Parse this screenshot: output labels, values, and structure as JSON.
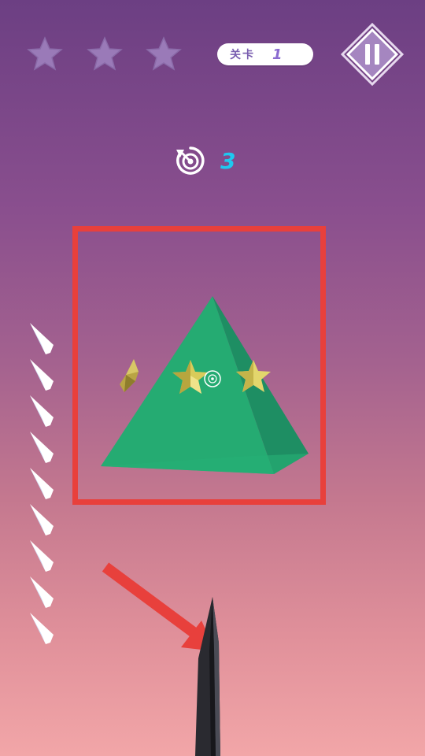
{
  "hud": {
    "stars": [
      {
        "icon": "star-icon",
        "earned": false
      },
      {
        "icon": "star-icon",
        "earned": false
      },
      {
        "icon": "star-icon",
        "earned": false
      }
    ],
    "level": {
      "label": "关卡",
      "value": "1"
    },
    "pause_icon": "pause-icon",
    "retries": {
      "icon": "retry-target-icon",
      "count": "3"
    }
  },
  "scene": {
    "target": {
      "shape": "pyramid",
      "color": "#25ab72"
    },
    "collectibles": [
      "gold-star-icon",
      "gold-star-icon",
      "gold-star-icon"
    ],
    "aim_icon": "crosshair-icon"
  },
  "knives": {
    "remaining": 9,
    "icon": "knife-icon"
  },
  "player_knife": {
    "icon": "knife-blade-icon"
  },
  "annotations": {
    "highlight_color": "#e8403c",
    "arrow_color": "#e8403c"
  },
  "colors": {
    "bg_top": "#6c3f83",
    "bg_bottom": "#f2a6a8",
    "retry_count": "#1fc8f0",
    "level_text": "#7a5fb0"
  }
}
